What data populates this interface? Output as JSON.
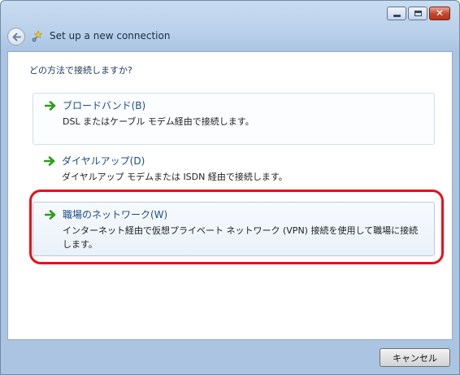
{
  "window": {
    "title": "Set up a new connection",
    "controls": {
      "minimize_icon": "minimize-icon",
      "maximize_icon": "maximize-icon",
      "close_icon": "close-icon",
      "close_glyph": "✕"
    }
  },
  "main": {
    "question": "どの方法で接続しますか?",
    "options": [
      {
        "title": "ブロードバンド(B)",
        "description": "DSL またはケーブル モデム経由で接続します。",
        "icon": "green-arrow-icon"
      },
      {
        "title": "ダイヤルアップ(D)",
        "description": "ダイヤルアップ モデムまたは ISDN 経由で接続します。",
        "icon": "green-arrow-icon"
      },
      {
        "title": "職場のネットワーク(W)",
        "description": "インターネット経由で仮想プライベート ネットワーク (VPN) 接続を使用して職場に接続します。",
        "icon": "green-arrow-icon"
      }
    ]
  },
  "footer": {
    "cancel_label": "キャンセル"
  },
  "colors": {
    "annotation_outline": "#e8101a",
    "link_text": "#1c4b8e",
    "arrow_green": "#2e9d1c"
  }
}
